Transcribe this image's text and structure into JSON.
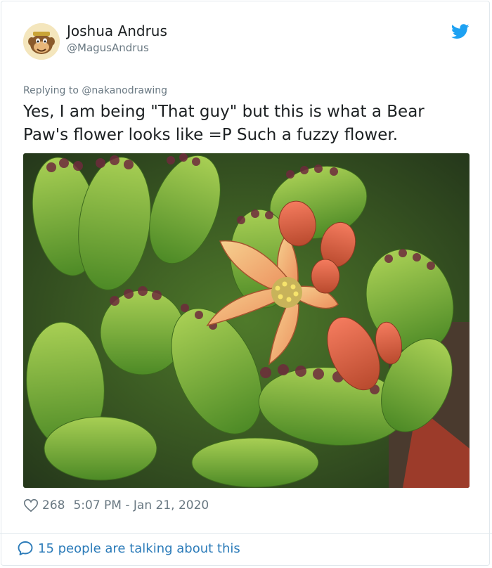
{
  "author": {
    "name": "Joshua Andrus",
    "handle": "@MagusAndrus",
    "avatar_icon": "monkey-avatar-icon"
  },
  "platform_icon": "twitter-bird-icon",
  "reply": {
    "prefix": "Replying to",
    "to_handle": "@nakanodrawing"
  },
  "tweet": {
    "text": "Yes, I am being \"That guy\" but this is what a Bear\nPaw's flower looks like =P Such a fuzzy flower.",
    "photo_alt": "Bear paw succulent with fuzzy green lobed leaves tipped in dark red and a pale orange star-shaped flower"
  },
  "footer": {
    "likes": "268",
    "timestamp": "5:07 PM - Jan 21, 2020",
    "talking": "15 people are talking about this"
  },
  "colors": {
    "link_blue": "#2b7bb9",
    "twitter_blue": "#1da1f2",
    "muted": "#697882",
    "text": "#1c2022",
    "border": "#e1e8ed"
  }
}
